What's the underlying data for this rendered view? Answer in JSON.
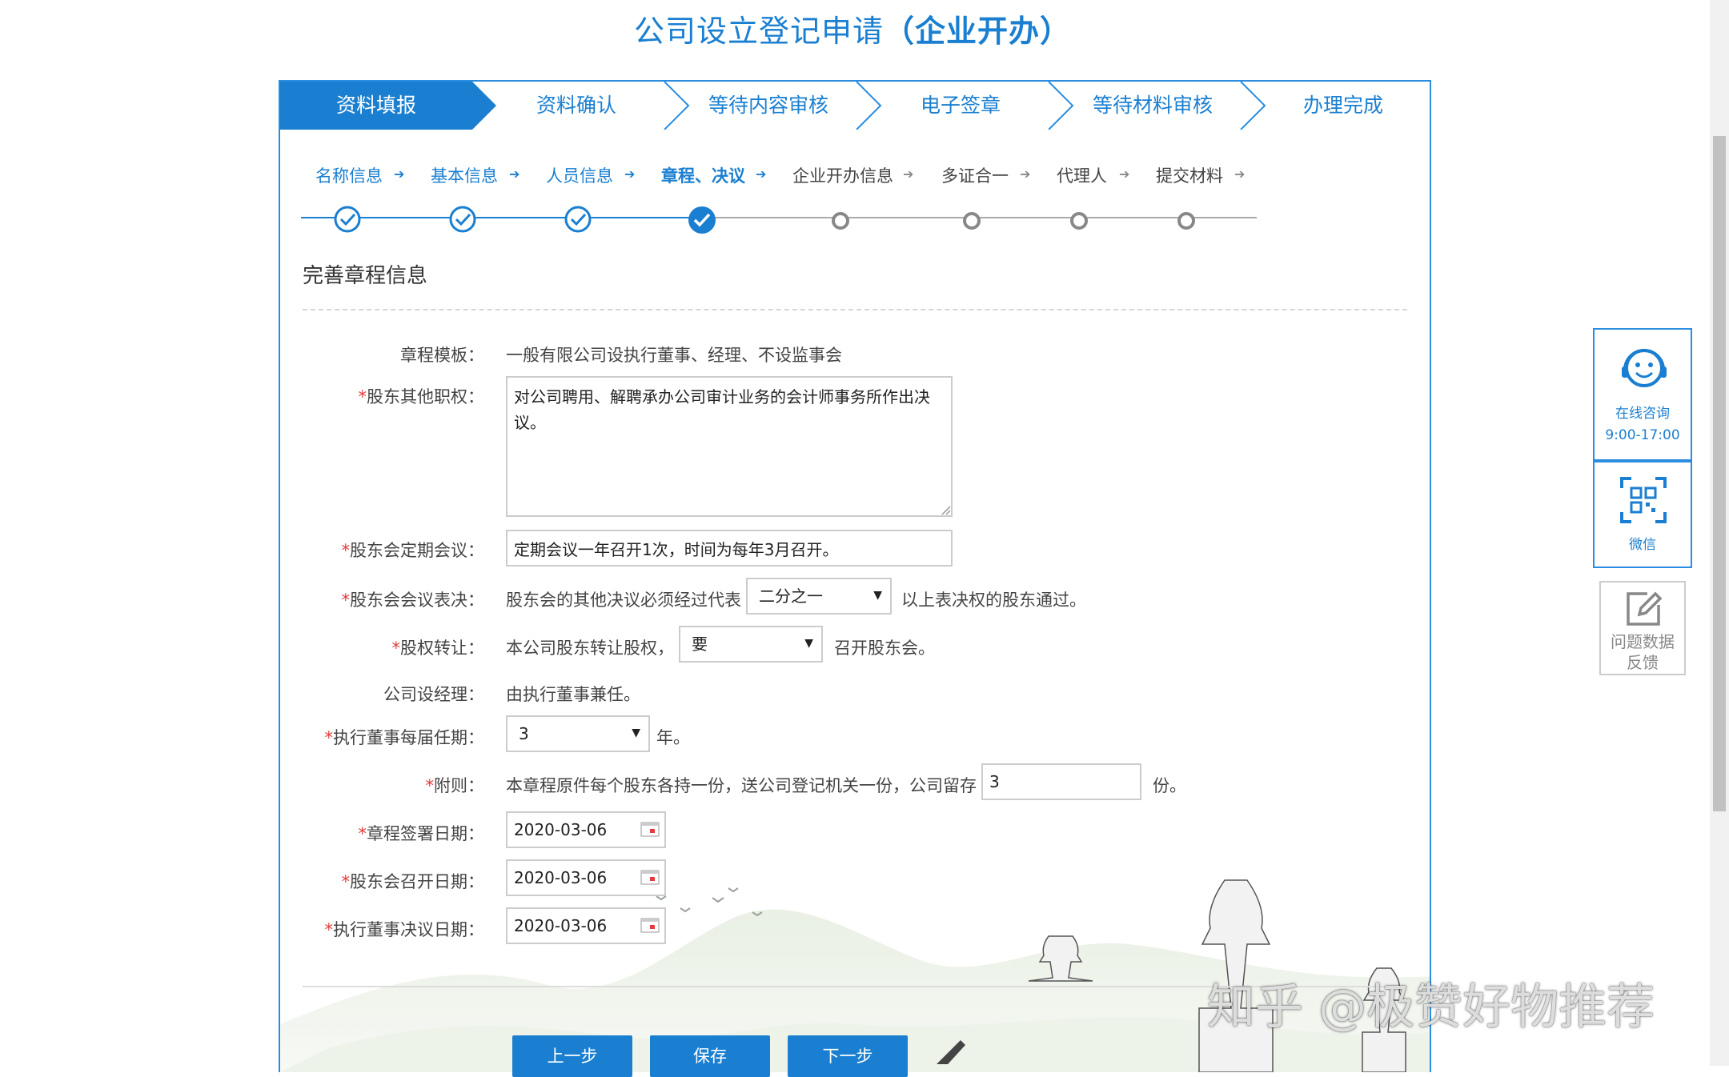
{
  "page": {
    "title_main": "公司设立登记申请",
    "title_sub": "（企业开办）"
  },
  "steps": [
    {
      "label": "资料填报",
      "state": "active"
    },
    {
      "label": "资料确认",
      "state": "pending"
    },
    {
      "label": "等待内容审核",
      "state": "pending"
    },
    {
      "label": "电子签章",
      "state": "pending"
    },
    {
      "label": "等待材料审核",
      "state": "pending"
    },
    {
      "label": "办理完成",
      "state": "pending"
    }
  ],
  "substeps": [
    {
      "label": "名称信息",
      "state": "done"
    },
    {
      "label": "基本信息",
      "state": "done"
    },
    {
      "label": "人员信息",
      "state": "done"
    },
    {
      "label": "章程、决议",
      "state": "active"
    },
    {
      "label": "企业开办信息",
      "state": "pending"
    },
    {
      "label": "多证合一",
      "state": "pending"
    },
    {
      "label": "代理人",
      "state": "pending"
    },
    {
      "label": "提交材料",
      "state": "pending"
    }
  ],
  "form": {
    "section_title": "完善章程信息",
    "template_label": "章程模板：",
    "template_value": "一般有限公司设执行董事、经理、不设监事会",
    "other_duties_label": "股东其他职权：",
    "other_duties_value": "对公司聘用、解聘承办公司审计业务的会计师事务所作出决议。",
    "regular_meeting_label": "股东会定期会议：",
    "regular_meeting_value": "定期会议一年召开1次，时间为每年3月召开。",
    "vote_label": "股东会会议表决：",
    "vote_prefix": "股东会的其他决议必须经过代表",
    "vote_select": "二分之一",
    "vote_suffix": "以上表决权的股东通过。",
    "transfer_label": "股权转让：",
    "transfer_prefix": "本公司股东转让股权，",
    "transfer_select": "要",
    "transfer_suffix": "召开股东会。",
    "manager_label": "公司设经理：",
    "manager_value": "由执行董事兼任。",
    "term_label": "执行董事每届任期：",
    "term_select": "3",
    "term_suffix": "年。",
    "appendix_label": "附则：",
    "appendix_prefix": "本章程原件每个股东各持一份，送公司登记机关一份，公司留存",
    "appendix_value": "3",
    "appendix_suffix": "份。",
    "sign_date_label": "章程签署日期：",
    "sign_date_value": "2020-03-06",
    "meeting_date_label": "股东会召开日期：",
    "meeting_date_value": "2020-03-06",
    "resolution_date_label": "执行董事决议日期：",
    "resolution_date_value": "2020-03-06",
    "required_mark": "*"
  },
  "buttons": {
    "prev": "上一步",
    "save": "保存",
    "next": "下一步"
  },
  "side": {
    "consult_label": "在线咨询",
    "consult_hours": "9:00-17:00",
    "wechat_label": "微信",
    "feedback_line1": "问题数据",
    "feedback_line2": "反馈"
  },
  "watermark": "知乎 @极赞好物推荐",
  "colors": {
    "primary": "#1a7fd1",
    "border": "#2a8de0",
    "required": "#e23b3b"
  }
}
